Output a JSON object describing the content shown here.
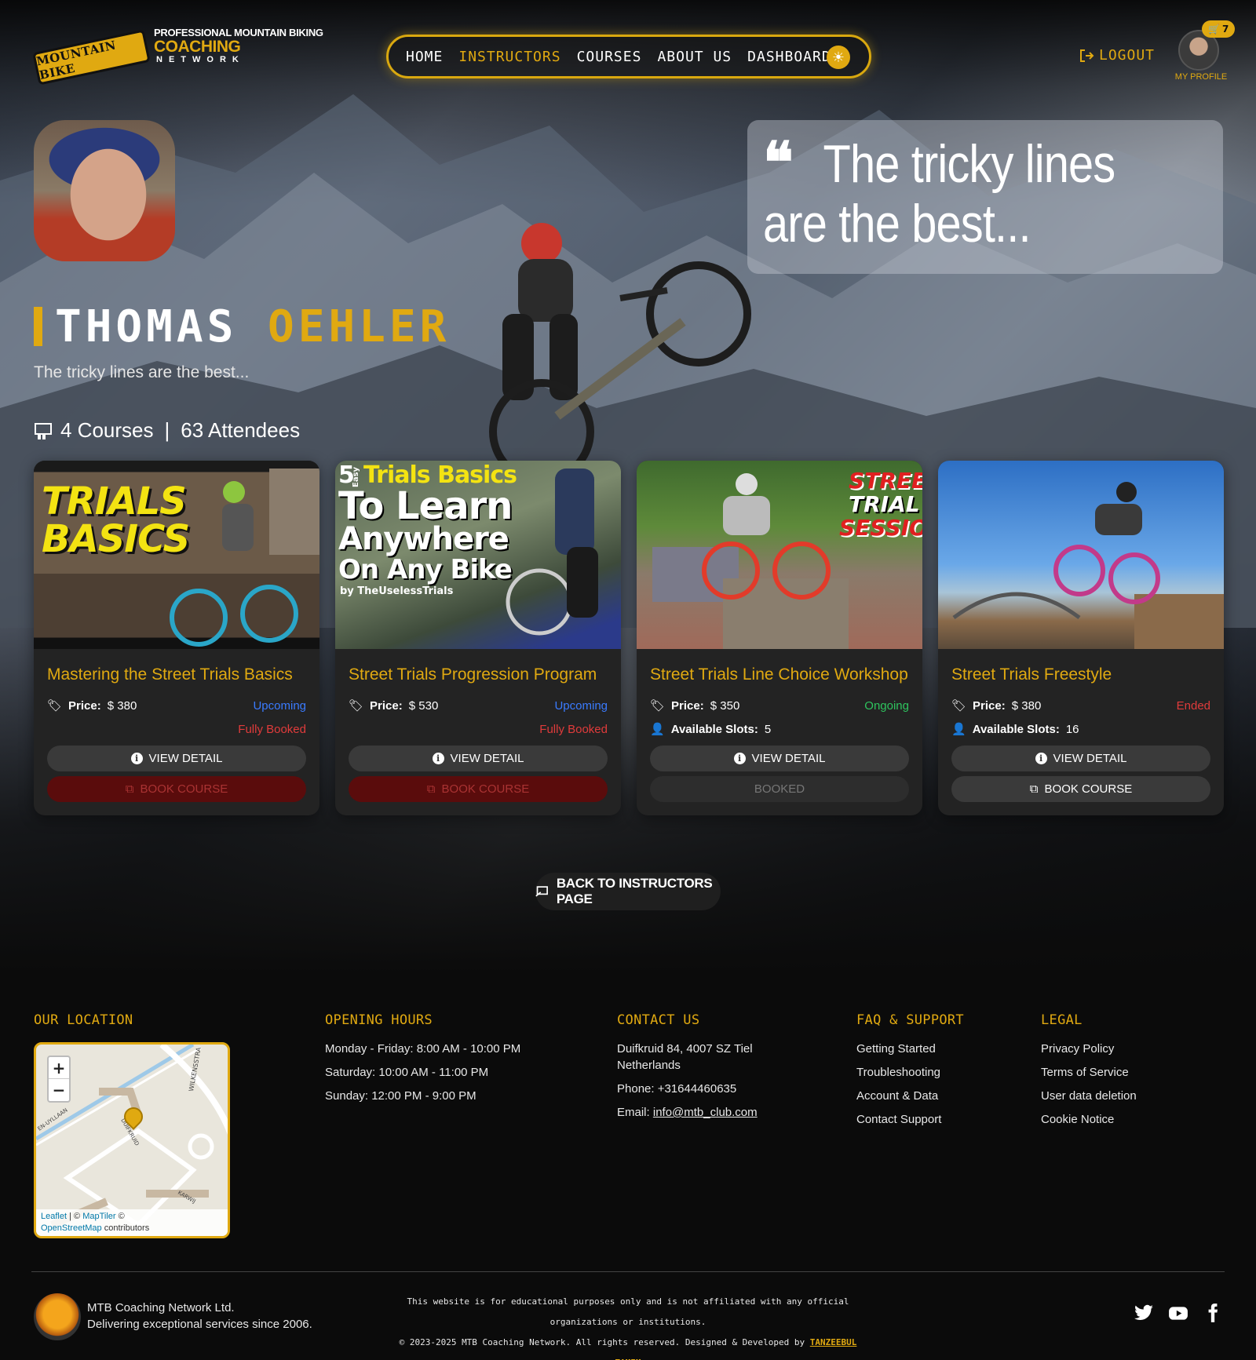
{
  "header": {
    "logo": {
      "badge_text": "MOUNTAIN BIKE",
      "line1": "PROFESSIONAL MOUNTAIN BIKING",
      "line2": "COACHING",
      "line3": "NETWORK"
    },
    "nav": [
      {
        "label": "HOME",
        "active": false
      },
      {
        "label": "INSTRUCTORS",
        "active": true
      },
      {
        "label": "COURSES",
        "active": false
      },
      {
        "label": "ABOUT US",
        "active": false
      },
      {
        "label": "DASHBOARD",
        "active": false
      }
    ],
    "theme_icon": "sun-icon",
    "logout_label": "LOGOUT",
    "cart_count": "7",
    "profile_label": "MY PROFILE"
  },
  "instructor": {
    "quote": "The tricky lines are the best...",
    "first_name": "THOMAS",
    "last_name": "OEHLER",
    "tagline": "The tricky lines are the best...",
    "courses_count": "4 Courses",
    "attendees": "63 Attendees"
  },
  "courses": [
    {
      "image_text": "TRIALS BASICS",
      "title": "Mastering the Street Trials Basics",
      "price_label": "Price:",
      "price": "$ 380",
      "status": "Upcoming",
      "booking_note": "Fully Booked",
      "slots_label": "",
      "slots": "",
      "view_label": "VIEW DETAIL",
      "book_label": "BOOK COURSE"
    },
    {
      "image_text_1": "5",
      "image_text_2": "Easy",
      "image_text_3": "Trials Basics",
      "image_text_4": "To Learn",
      "image_text_5": "Anywhere",
      "image_text_6": "On Any Bike",
      "image_text_7": "by TheUselessTrials",
      "title": "Street Trials Progression Program",
      "price_label": "Price:",
      "price": "$ 530",
      "status": "Upcoming",
      "booking_note": "Fully Booked",
      "view_label": "VIEW DETAIL",
      "book_label": "BOOK COURSE"
    },
    {
      "image_text_1": "STREE",
      "image_text_2": "TRIAL",
      "image_text_3": "SESSIO",
      "title": "Street Trials Line Choice Workshop",
      "price_label": "Price:",
      "price": "$ 350",
      "status": "Ongoing",
      "slots_label": "Available Slots:",
      "slots": "5",
      "view_label": "VIEW DETAIL",
      "book_label": "BOOKED"
    },
    {
      "title": "Street Trials Freestyle",
      "price_label": "Price:",
      "price": "$ 380",
      "status": "Ended",
      "slots_label": "Available Slots:",
      "slots": "16",
      "view_label": "VIEW DETAIL",
      "book_label": "BOOK COURSE"
    }
  ],
  "back_label": "BACK TO INSTRUCTORS PAGE",
  "footer": {
    "location": {
      "heading": "OUR LOCATION",
      "map_streets": [
        "DUIFKRUID",
        "WILKENSSTRA",
        "KARWIJ",
        "EN-UYLLAAN"
      ],
      "attribution_leaflet": "Leaflet",
      "attribution_sep": "| ©",
      "attribution_maptiler": "MapTiler",
      "attribution_copy": "©",
      "attribution_osm": "OpenStreetMap",
      "attribution_contrib": "contributors"
    },
    "hours": {
      "heading": "OPENING HOURS",
      "lines": [
        "Monday - Friday: 8:00 AM - 10:00 PM",
        "Saturday: 10:00 AM - 11:00 PM",
        "Sunday: 12:00 PM - 9:00 PM"
      ]
    },
    "contact": {
      "heading": "CONTACT US",
      "address1": "Duifkruid 84, 4007 SZ Tiel",
      "address2": "Netherlands",
      "phone": "Phone: +31644460635",
      "email_label": "Email:",
      "email": "info@mtb_club.com"
    },
    "faq": {
      "heading": "FAQ & SUPPORT",
      "links": [
        "Getting Started",
        "Troubleshooting",
        "Account & Data",
        "Contact Support"
      ]
    },
    "legal": {
      "heading": "LEGAL",
      "links": [
        "Privacy Policy",
        "Terms of Service",
        "User data deletion",
        "Cookie Notice"
      ]
    },
    "company_name": "MTB Coaching Network Ltd.",
    "company_tagline": "Delivering exceptional services since 2006.",
    "disclaimer": "This website is for educational purposes only and is not affiliated with any official organizations or institutions.",
    "copyright": "© 2023-2025 MTB Coaching Network. All rights reserved. Designed & Developed by",
    "developer": "TANZEEBUL TAMIM",
    "socials": [
      "twitter-icon",
      "youtube-icon",
      "facebook-icon"
    ]
  },
  "colors": {
    "accent": "#e0a911",
    "upcoming": "#3a7bff",
    "ongoing": "#2ec45e",
    "ended": "#e03b3b"
  }
}
